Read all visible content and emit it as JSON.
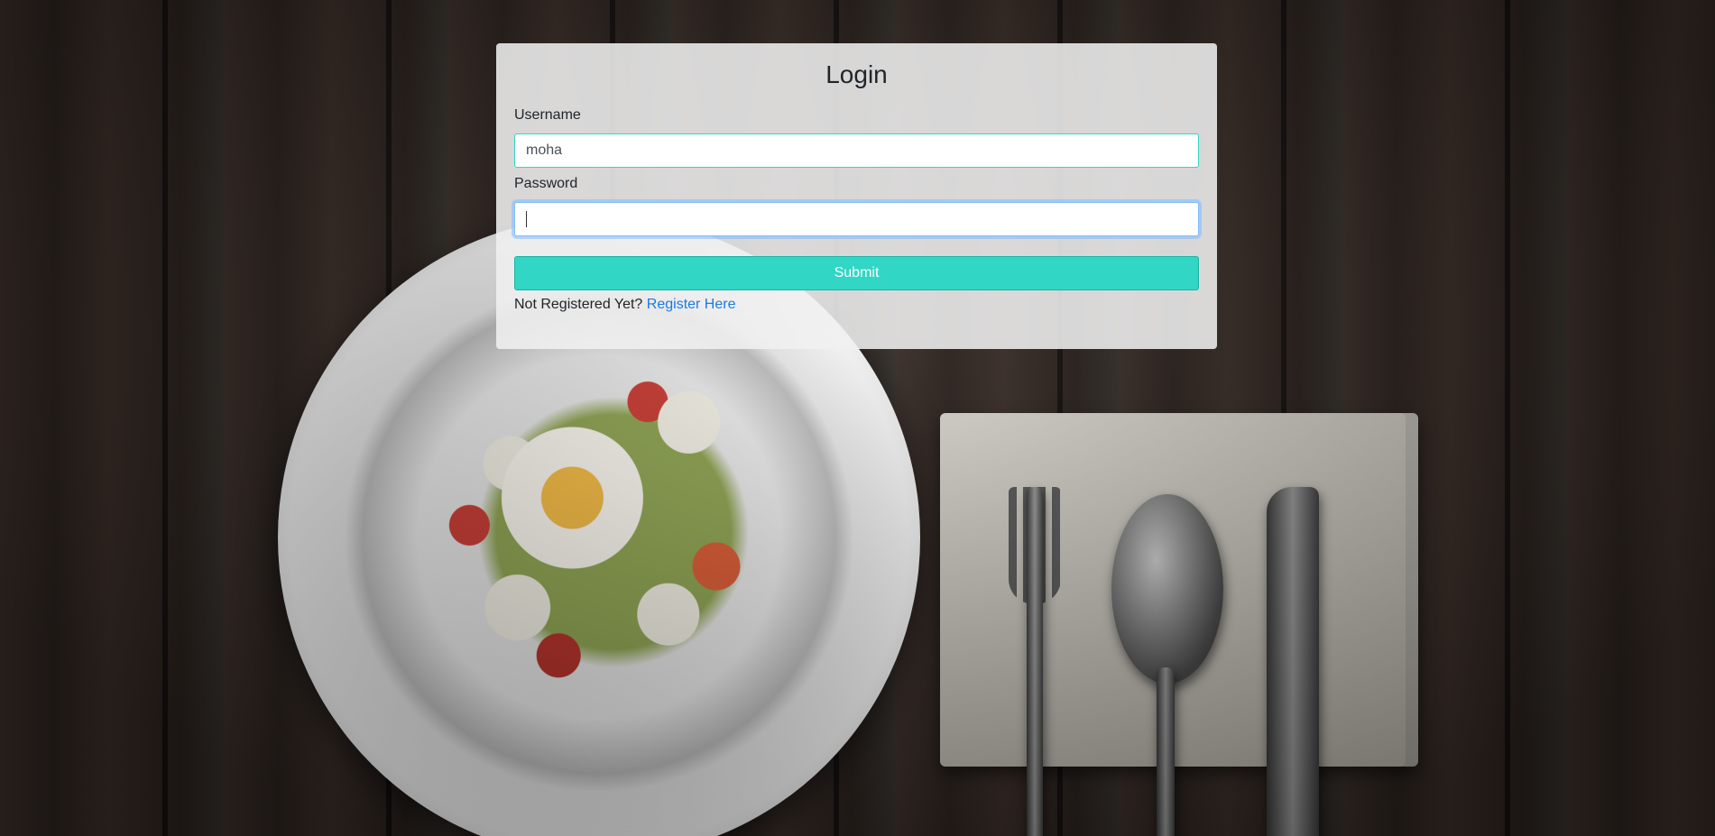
{
  "login": {
    "title": "Login",
    "username_label": "Username",
    "username_value": "moha",
    "password_label": "Password",
    "password_value": "",
    "submit_label": "Submit",
    "register_prompt": "Not Registered Yet?",
    "register_link": "Register Here"
  },
  "colors": {
    "accent": "#31d6c5",
    "link": "#1a7ae6",
    "focus_ring": "#80bdff"
  },
  "background": {
    "description_icons": [
      "plate-image",
      "fork-icon",
      "spoon-icon",
      "knife-icon",
      "napkin-image"
    ]
  }
}
